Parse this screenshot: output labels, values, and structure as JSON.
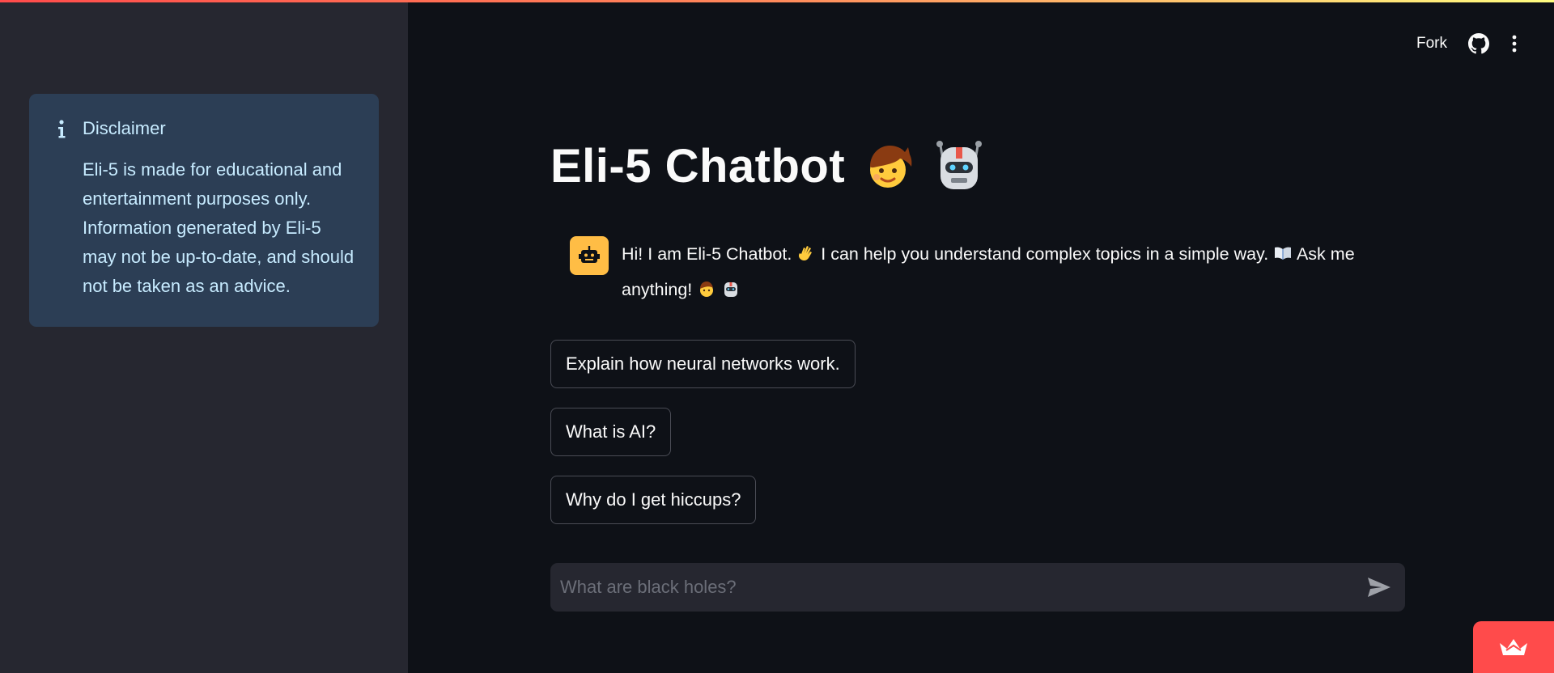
{
  "header": {
    "fork_label": "Fork",
    "github_icon": "github-icon",
    "menu_icon": "kebab-menu-icon"
  },
  "sidebar": {
    "alert": {
      "icon": "info-icon",
      "title": "Disclaimer",
      "body": "Eli-5 is made for educational and entertainment purposes only. Information generated by Eli-5 may not be up-to-date, and should not be taken as an advice."
    }
  },
  "main": {
    "title": "Eli-5 Chatbot",
    "title_emojis": [
      "child-emoji",
      "robot-emoji"
    ],
    "assistant_message": {
      "avatar_icon": "bot-avatar-icon",
      "parts": [
        "Hi! I am Eli-5 Chatbot.",
        "I can help you understand complex topics in a simple way.",
        "Ask me anything!"
      ],
      "emojis": [
        "waving-hand-emoji",
        "open-book-emoji",
        "child-emoji",
        "robot-emoji"
      ]
    },
    "suggestions": [
      "Explain how neural networks work.",
      "What is AI?",
      "Why do I get hiccups?"
    ],
    "chat_input": {
      "placeholder": "What are black holes?",
      "send_icon": "send-icon"
    }
  },
  "badge": {
    "icon": "crown-icon"
  },
  "colors": {
    "background": "#0e1117",
    "sidebar": "#262730",
    "alert_bg": "#2c3e55",
    "alert_text": "#c7ebff",
    "avatar": "#ffbd45",
    "badge": "#ff4b4b"
  }
}
